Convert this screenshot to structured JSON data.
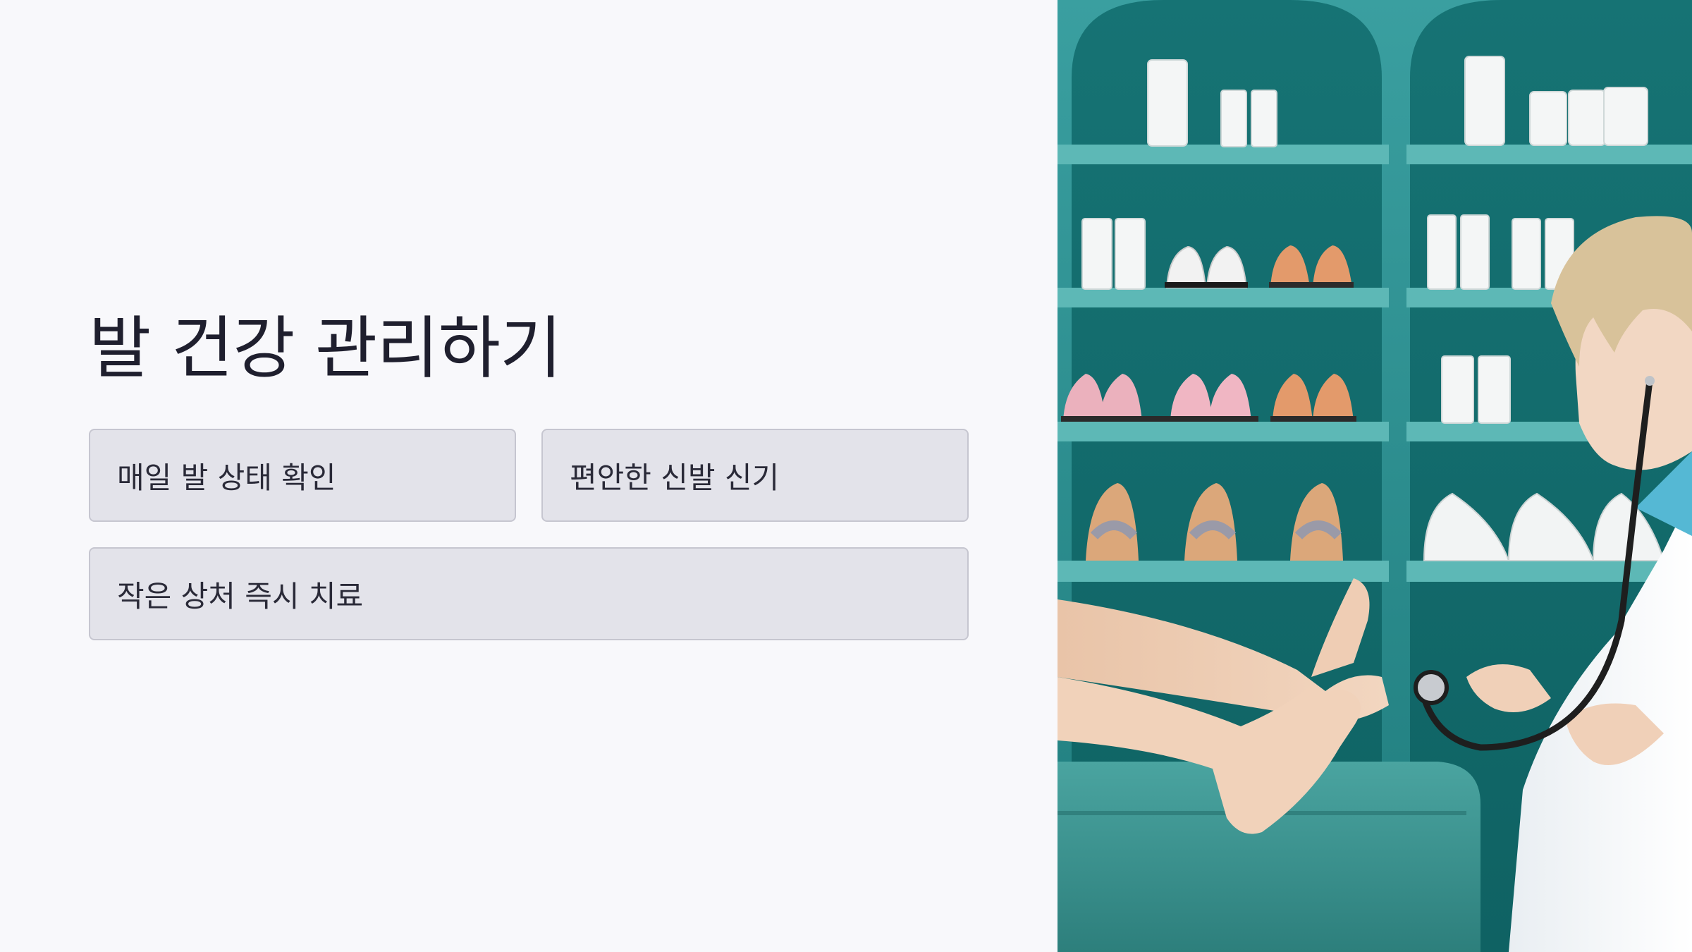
{
  "slide": {
    "title": "발 건강 관리하기",
    "cards": [
      {
        "label": "매일 발 상태 확인"
      },
      {
        "label": "편안한 신발 신기"
      },
      {
        "label": "작은 상처 즉시 치료"
      }
    ]
  },
  "photo": {
    "icon": "foot-care-clinic-photo"
  },
  "colors": {
    "background": "#f8f8fb",
    "card_fill": "#e3e3ea",
    "card_border": "#c6c6d0",
    "text": "#1f1f2e",
    "teal": "#2a8b8c"
  }
}
